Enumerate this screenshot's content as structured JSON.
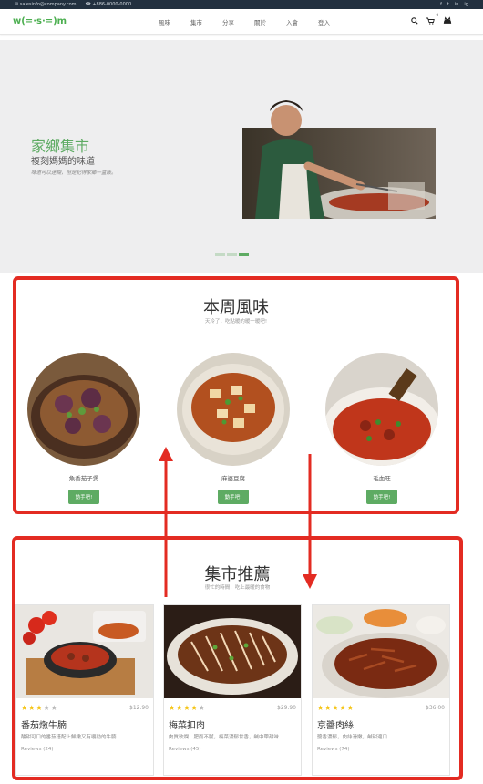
{
  "topbar": {
    "email": "salesinfo@company.com",
    "phone": "+886-0000-0000",
    "social": [
      "f",
      "t",
      "in",
      "ig"
    ]
  },
  "nav": {
    "logo": "w(=·s·=)m",
    "menu": [
      "風味",
      "集市",
      "分享",
      "關於",
      "入會",
      "登入"
    ],
    "cart_count": "0"
  },
  "hero": {
    "title": "家鄉集市",
    "subtitle": "複刻媽媽的味道",
    "description": "味道可以迷糊，但是記得家鄉一盒飯。"
  },
  "weekly": {
    "title": "本周風味",
    "subtitle": "天冷了，吃點暖的暖一暖吧!",
    "dishes": [
      {
        "name": "魚香茄子煲",
        "button": "動手吧!"
      },
      {
        "name": "麻婆豆腐",
        "button": "動手吧!"
      },
      {
        "name": "毛血旺",
        "button": "動手吧!"
      }
    ]
  },
  "market": {
    "title": "集市推薦",
    "subtitle": "很忙的時間，吃上最暖的食物",
    "products": [
      {
        "name": "番茄燉牛腩",
        "price": "$12.90",
        "rating": 3,
        "desc": "酸甜可口的番茄搭配上鮮嫩又有嚼勁的牛腩",
        "reviews": "Reviews (24)"
      },
      {
        "name": "梅菜扣肉",
        "price": "$29.90",
        "rating": 4,
        "desc": "肉質軟爛、肥而不膩，梅菜濃郁甘香，鹹中帶甜味",
        "reviews": "Reviews (45)"
      },
      {
        "name": "京醬肉絲",
        "price": "$36.00",
        "rating": 5,
        "desc": "醬香濃郁，肉絲滑嫩，鹹甜適口",
        "reviews": "Reviews (74)"
      }
    ]
  },
  "colors": {
    "accent": "#5eab63",
    "annotation": "#e32b22",
    "topbar": "#22303f"
  }
}
